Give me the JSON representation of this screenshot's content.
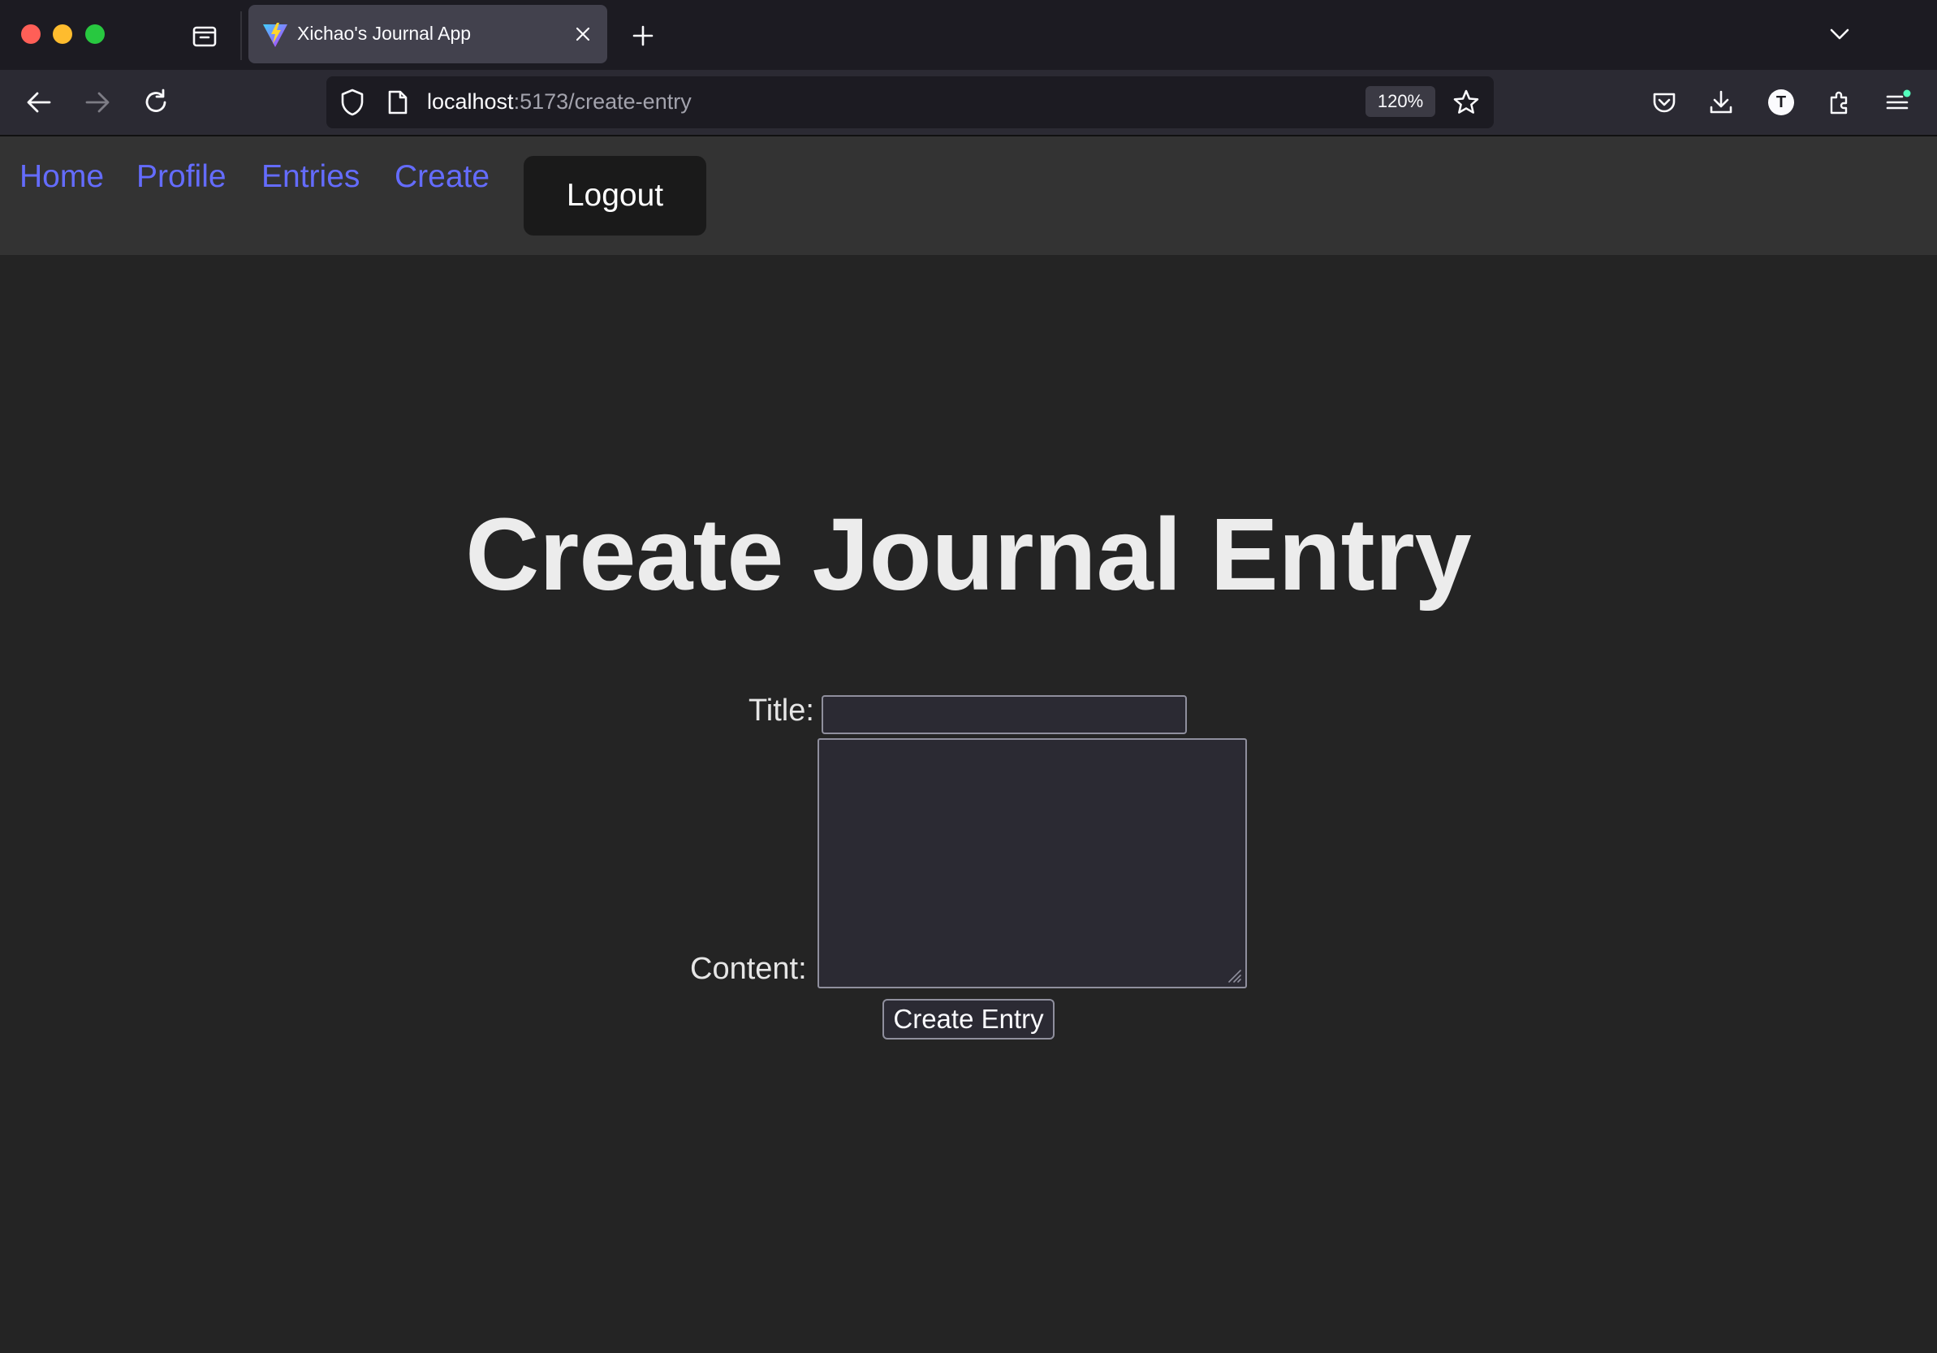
{
  "browser": {
    "tab": {
      "title": "Xichao's Journal App"
    },
    "url": {
      "host": "localhost",
      "path": ":5173/create-entry"
    },
    "zoom": "120%",
    "account_initial": "T",
    "colors": {
      "tabstrip_bg": "#1c1b22",
      "toolbar_bg": "#2b2a33",
      "active_tab_bg": "#42414d"
    }
  },
  "site_nav": {
    "links": [
      {
        "label": "Home"
      },
      {
        "label": "Profile"
      },
      {
        "label": "Entries"
      },
      {
        "label": "Create"
      }
    ],
    "logout_label": "Logout",
    "colors": {
      "link": "#646cff",
      "header_bg": "#333333",
      "logout_bg": "#1a1a1a"
    }
  },
  "form": {
    "heading": "Create Journal Entry",
    "title_label": "Title:",
    "title_value": "",
    "content_label": "Content:",
    "content_value": "",
    "submit_label": "Create Entry"
  }
}
